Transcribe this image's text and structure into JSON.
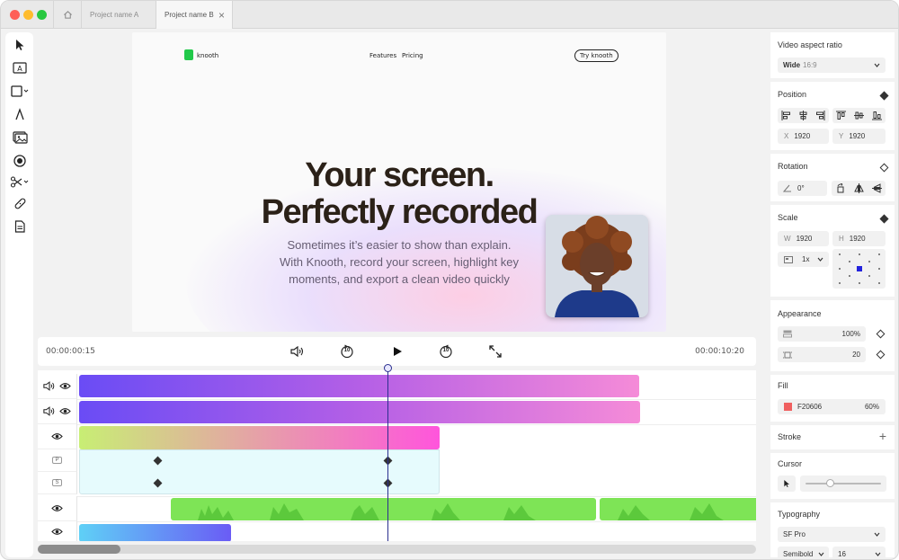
{
  "tabs": {
    "home_icon": "home-icon",
    "tab_a": "Project name A",
    "tab_b": "Project name B",
    "close": "×"
  },
  "canvas": {
    "logo_text": "knooth",
    "nav_features": "Features",
    "nav_pricing": "Pricing",
    "cta": "Try knooth",
    "headline_1": "Your screen.",
    "headline_2": "Perfectly recorded",
    "subtext_1": "Sometimes it’s easier to show than explain.",
    "subtext_2": "With Knooth, record your screen, highlight key",
    "subtext_3": "moments, and export a clean video quickly"
  },
  "player": {
    "current_time": "00:00:00:15",
    "total_time": "00:00:10:20",
    "rewind_label": "10",
    "forward_label": "10"
  },
  "timeline": {
    "track_p": "P",
    "track_s": "S",
    "playhead_fraction": 0.44
  },
  "panel": {
    "aspect_title": "Video aspect ratio",
    "aspect_value": "Wide",
    "aspect_ratio": "16:9",
    "position_title": "Position",
    "x_label": "X",
    "x_value": "1920",
    "y_label": "Y",
    "y_value": "1920",
    "rotation_title": "Rotation",
    "rotation_value": "0°",
    "scale_title": "Scale",
    "w_label": "W",
    "w_value": "1920",
    "h_label": "H",
    "h_value": "1920",
    "scale_mode": "1x",
    "appearance_title": "Appearance",
    "opacity_value": "100%",
    "radius_value": "20",
    "fill_title": "Fill",
    "fill_hex": "F20606",
    "fill_opacity": "60%",
    "fill_color": "#f06060",
    "stroke_title": "Stroke",
    "stroke_add": "+",
    "cursor_title": "Cursor",
    "cursor_size_fraction": 0.3,
    "typography_title": "Typography",
    "font_family": "SF Pro",
    "font_weight": "Semibold",
    "font_size": "16"
  },
  "colors": {
    "accent": "#2b2f8f",
    "traffic_red": "#fe5f57",
    "traffic_yellow": "#febc2e",
    "traffic_green": "#28c840"
  }
}
